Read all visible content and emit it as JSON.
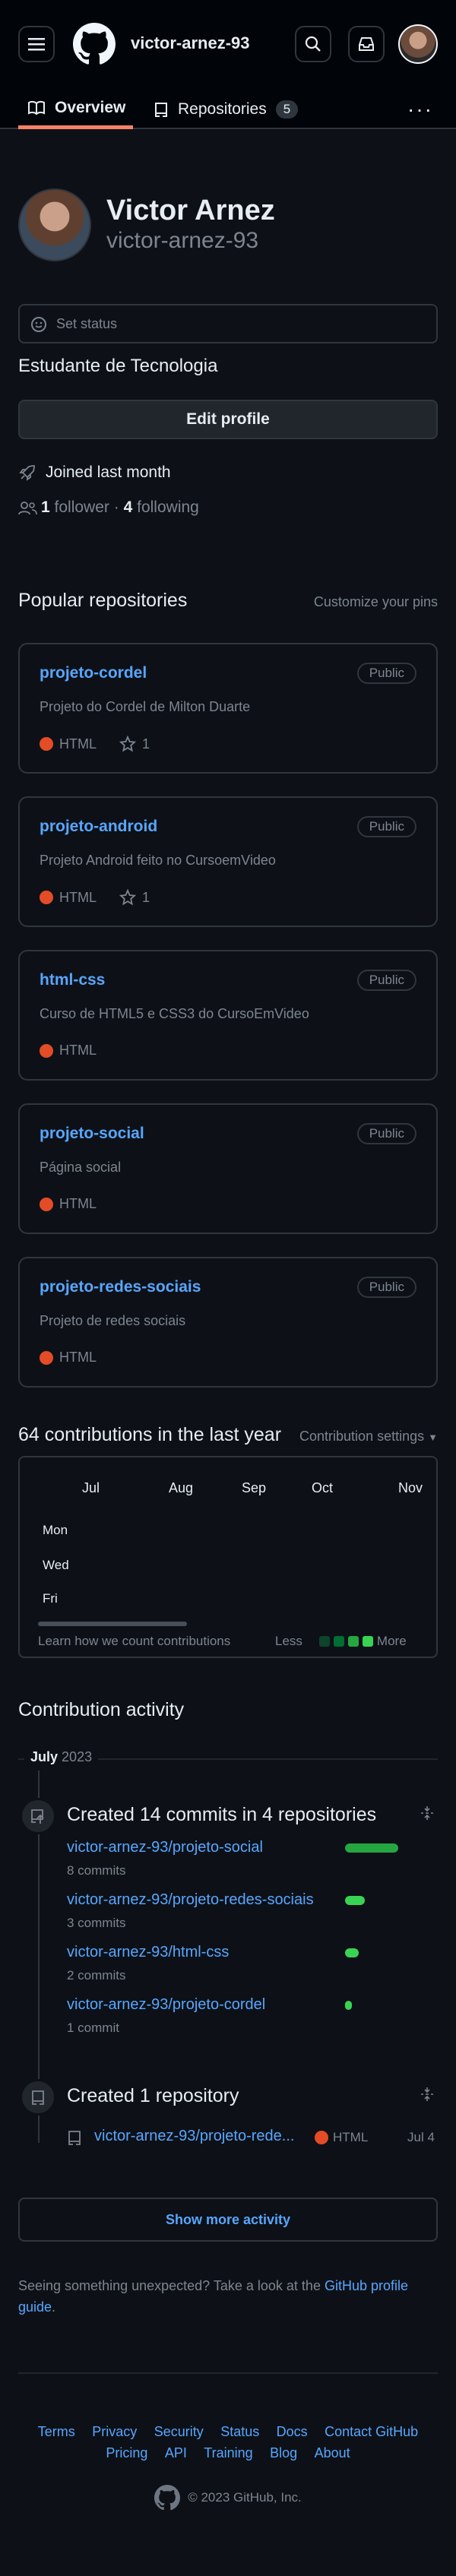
{
  "header": {
    "username": "victor-arnez-93"
  },
  "tabs": [
    {
      "label": "Overview"
    },
    {
      "label": "Repositories",
      "count": "5"
    }
  ],
  "profile": {
    "name": "Victor Arnez",
    "login": "victor-arnez-93",
    "status_placeholder": "Set status",
    "bio": "Estudante de Tecnologia",
    "edit_label": "Edit profile",
    "joined": "Joined last month",
    "followers_count": "1",
    "followers_label": "follower",
    "sep": "·",
    "following_count": "4",
    "following_label": "following"
  },
  "popular": {
    "title": "Popular repositories",
    "customize": "Customize your pins",
    "repos": [
      {
        "name": "projeto-cordel",
        "visibility": "Public",
        "desc": "Projeto do Cordel de Milton Duarte",
        "lang": "HTML",
        "stars": "1"
      },
      {
        "name": "projeto-android",
        "visibility": "Public",
        "desc": "Projeto Android feito no CursoemVideo",
        "lang": "HTML",
        "stars": "1"
      },
      {
        "name": "html-css",
        "visibility": "Public",
        "desc": "Curso de HTML5 e CSS3 do CursoEmVideo",
        "lang": "HTML",
        "stars": ""
      },
      {
        "name": "projeto-social",
        "visibility": "Public",
        "desc": "Página social",
        "lang": "HTML",
        "stars": ""
      },
      {
        "name": "projeto-redes-sociais",
        "visibility": "Public",
        "desc": "Projeto de redes sociais",
        "lang": "HTML",
        "stars": ""
      }
    ]
  },
  "contributions": {
    "title": "64 contributions in the last year",
    "settings": "Contribution settings",
    "months": [
      "Jul",
      "Aug",
      "Sep",
      "Oct",
      "Nov"
    ],
    "days": [
      "Mon",
      "Wed",
      "Fri"
    ],
    "learn": "Learn how we count contributions",
    "less": "Less",
    "more": "More"
  },
  "activity": {
    "title": "Contribution activity",
    "month": "July",
    "year": "2023",
    "commits_title": "Created 14 commits in 4 repositories",
    "commits": [
      {
        "repo": "victor-arnez-93/projeto-social",
        "count": "8 commits",
        "value": 8
      },
      {
        "repo": "victor-arnez-93/projeto-redes-sociais",
        "count": "3 commits",
        "value": 3
      },
      {
        "repo": "victor-arnez-93/html-css",
        "count": "2 commits",
        "value": 2
      },
      {
        "repo": "victor-arnez-93/projeto-cordel",
        "count": "1 commit",
        "value": 1
      }
    ],
    "created_title": "Created 1 repository",
    "created_repo": "victor-arnez-93/projeto-rede...",
    "created_lang": "HTML",
    "created_date": "Jul 4",
    "show_more": "Show more activity"
  },
  "notice": {
    "text": "Seeing something unexpected? Take a look at the",
    "link": "GitHub profile guide",
    "end": "."
  },
  "footer": {
    "links_row1": [
      "Terms",
      "Privacy",
      "Security",
      "Status",
      "Docs",
      "Contact GitHub"
    ],
    "links_row2": [
      "Pricing",
      "API",
      "Training",
      "Blog",
      "About"
    ],
    "copyright": "© 2023 GitHub, Inc."
  },
  "colors": {
    "accent": "#58a6ff",
    "tab_underline": "#f78166",
    "html_lang": "#e34c26",
    "green": "#39d353"
  }
}
